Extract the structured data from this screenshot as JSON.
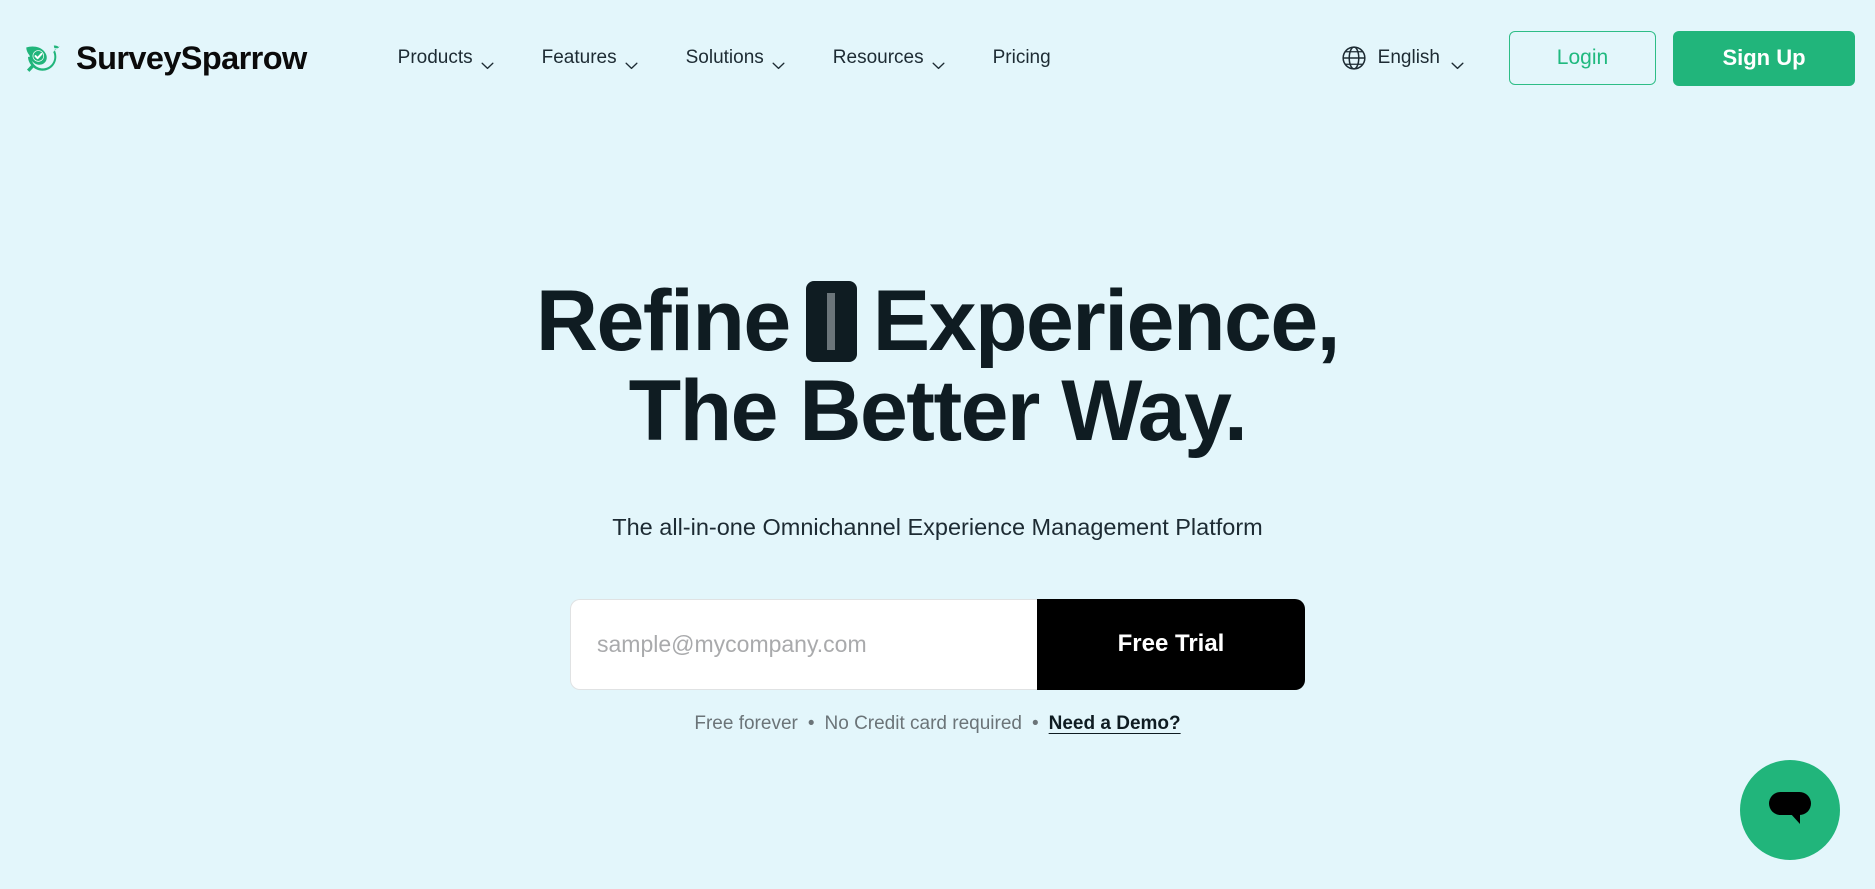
{
  "theme": {
    "page_background": "#e3f6fb",
    "brand_green": "#21b57b",
    "headline_color": "#0f1c22",
    "cta_black": "#000000"
  },
  "header": {
    "brand": {
      "name": "SurveySparrow",
      "logo_icon": "sparrow-check-logo"
    },
    "nav_items": [
      {
        "label": "Products",
        "has_dropdown": true
      },
      {
        "label": "Features",
        "has_dropdown": true
      },
      {
        "label": "Solutions",
        "has_dropdown": true
      },
      {
        "label": "Resources",
        "has_dropdown": true
      },
      {
        "label": "Pricing",
        "has_dropdown": false
      }
    ],
    "language": {
      "icon": "globe-icon",
      "selected": "English",
      "has_dropdown": true
    },
    "login_label": "Login",
    "signup_label": "Sign Up"
  },
  "hero": {
    "title_line_1_before": "Refine",
    "title_line_1_after": "Experience,",
    "title_line_2": "The Better Way.",
    "typing_cursor": "text-typing-cursor",
    "subtitle": "The all-in-one Omnichannel Experience Management Platform",
    "form": {
      "email_placeholder": "sample@mycompany.com",
      "email_value": "",
      "submit_label": "Free Trial"
    },
    "note": {
      "item_1": "Free forever",
      "separator": "•",
      "item_2": "No Credit card required",
      "demo_link": "Need a Demo?"
    }
  },
  "chat_widget": {
    "icon": "chat-bubble-icon",
    "background": "#21b57b"
  }
}
